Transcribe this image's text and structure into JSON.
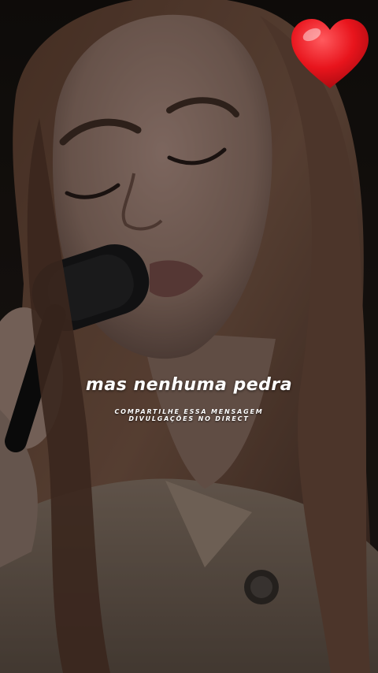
{
  "photo": {
    "subject": "singer-with-microphone"
  },
  "overlay": {
    "icon": "heart-icon",
    "heart_color": "#e8141c"
  },
  "lyrics": {
    "line": "mas nenhuma pedra"
  },
  "footer": {
    "line1": "COMPARTILHE ESSA MENSAGEM",
    "line2": "DIVULGAÇÕES NO DIRECT"
  }
}
